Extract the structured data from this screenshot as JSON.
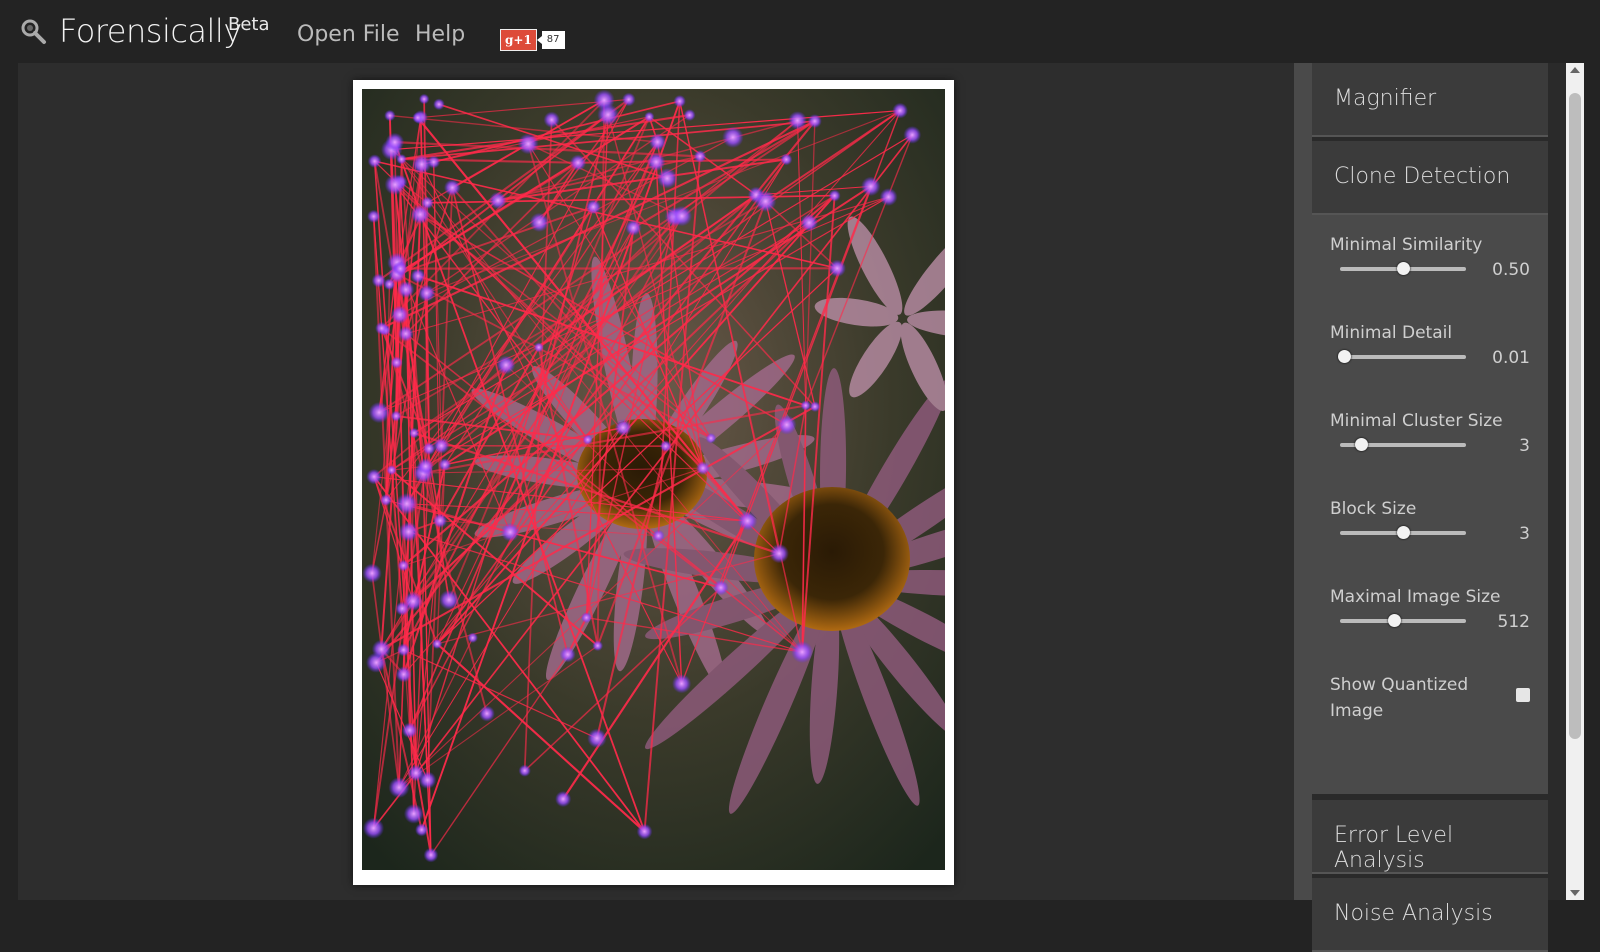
{
  "header": {
    "app_title": "Forensically",
    "app_badge": "Beta",
    "menu": [
      "Open File",
      "Help"
    ],
    "gplus_label": "g+1",
    "gplus_count": "87"
  },
  "sidebar": {
    "panels": {
      "magnifier": "Magnifier",
      "clone_detection": "Clone Detection",
      "error_level": "Error Level Analysis",
      "noise": "Noise Analysis"
    },
    "clone_detection": {
      "controls": [
        {
          "label": "Minimal Similarity",
          "value": "0.50",
          "fraction": 0.5
        },
        {
          "label": "Minimal Detail",
          "value": "0.01",
          "fraction": 0.03
        },
        {
          "label": "Minimal Cluster Size",
          "value": "3",
          "fraction": 0.17
        },
        {
          "label": "Block Size",
          "value": "3",
          "fraction": 0.5
        },
        {
          "label": "Maximal Image Size",
          "value": "512",
          "fraction": 0.43
        }
      ],
      "show_quantized_label_line1": "Show Quantized",
      "show_quantized_label_line2": "Image",
      "show_quantized_checked": false
    }
  },
  "colors": {
    "background": "#232323",
    "workspace": "#2d2d2d",
    "panel": "#3b3b3b",
    "panel_body": "#4a4a4a",
    "clone_lines": "#ff2a4a",
    "clone_points": "#9b4dff"
  }
}
